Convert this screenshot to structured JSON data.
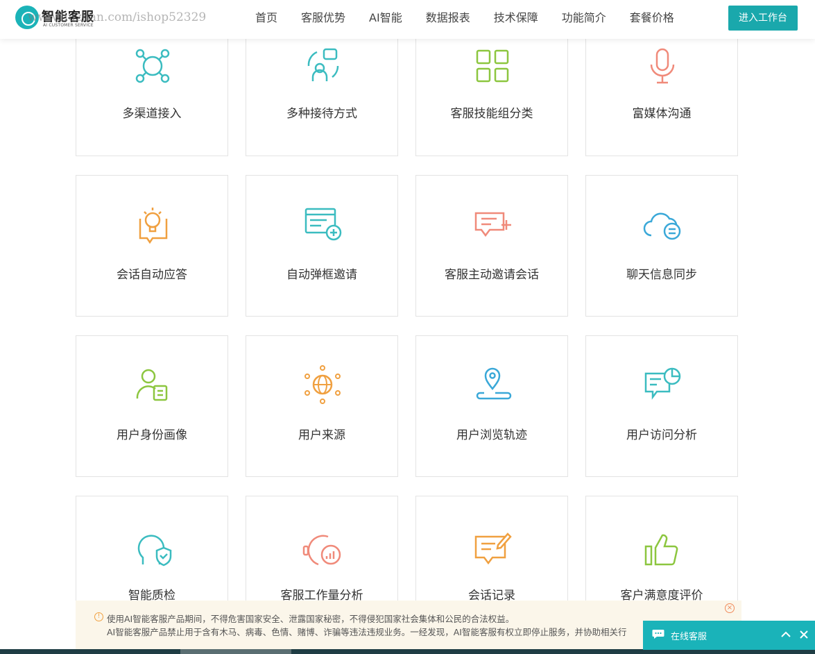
{
  "header": {
    "logo_title": "智能客服",
    "logo_subtitle": "AI CUSTOMER SERVICE",
    "watermark": "www.huzhan.com/ishop52329",
    "nav": [
      "首页",
      "客服优势",
      "AI智能",
      "数据报表",
      "技术保障",
      "功能简介",
      "套餐价格"
    ],
    "cta": "进入工作台"
  },
  "features": [
    {
      "label": "多渠道接入",
      "icon": "multi-channel-icon",
      "color": "#3bbcc0"
    },
    {
      "label": "多种接待方式",
      "icon": "reception-modes-icon",
      "color": "#3bbcc0"
    },
    {
      "label": "客服技能组分类",
      "icon": "skill-group-icon",
      "color": "#8cc63f"
    },
    {
      "label": "富媒体沟通",
      "icon": "microphone-icon",
      "color": "#f08a7a"
    },
    {
      "label": "会话自动应答",
      "icon": "lightbulb-chat-icon",
      "color": "#f0a040"
    },
    {
      "label": "自动弹框邀请",
      "icon": "popup-invite-icon",
      "color": "#3bbcc0"
    },
    {
      "label": "客服主动邀请会话",
      "icon": "chat-add-icon",
      "color": "#f08a7a"
    },
    {
      "label": "聊天信息同步",
      "icon": "cloud-sync-icon",
      "color": "#3aa8d8"
    },
    {
      "label": "用户身份画像",
      "icon": "user-profile-icon",
      "color": "#8cc63f"
    },
    {
      "label": "用户来源",
      "icon": "globe-network-icon",
      "color": "#f0a040"
    },
    {
      "label": "用户浏览轨迹",
      "icon": "location-track-icon",
      "color": "#3aa8d8"
    },
    {
      "label": "用户访问分析",
      "icon": "visit-analysis-icon",
      "color": "#3bbcc0"
    },
    {
      "label": "智能质检",
      "icon": "ai-inspection-icon",
      "color": "#3bbcc0"
    },
    {
      "label": "客服工作量分析",
      "icon": "workload-chart-icon",
      "color": "#f08a7a"
    },
    {
      "label": "会话记录",
      "icon": "chat-record-icon",
      "color": "#f0a040"
    },
    {
      "label": "客户满意度评价",
      "icon": "thumbs-up-icon",
      "color": "#8cc63f"
    }
  ],
  "notice": {
    "line1": "使用AI智能客服产品期间，不得危害国家安全、泄露国家秘密，不得侵犯国家社会集体和公民的合法权益。",
    "line2": "AI智能客服产品禁止用于含有木马、病毒、色情、赌博、诈骗等违法违规业务。一经发现，AI智能客服有权立即停止服务，并协助相关行"
  },
  "chat": {
    "label": "在线客服"
  }
}
